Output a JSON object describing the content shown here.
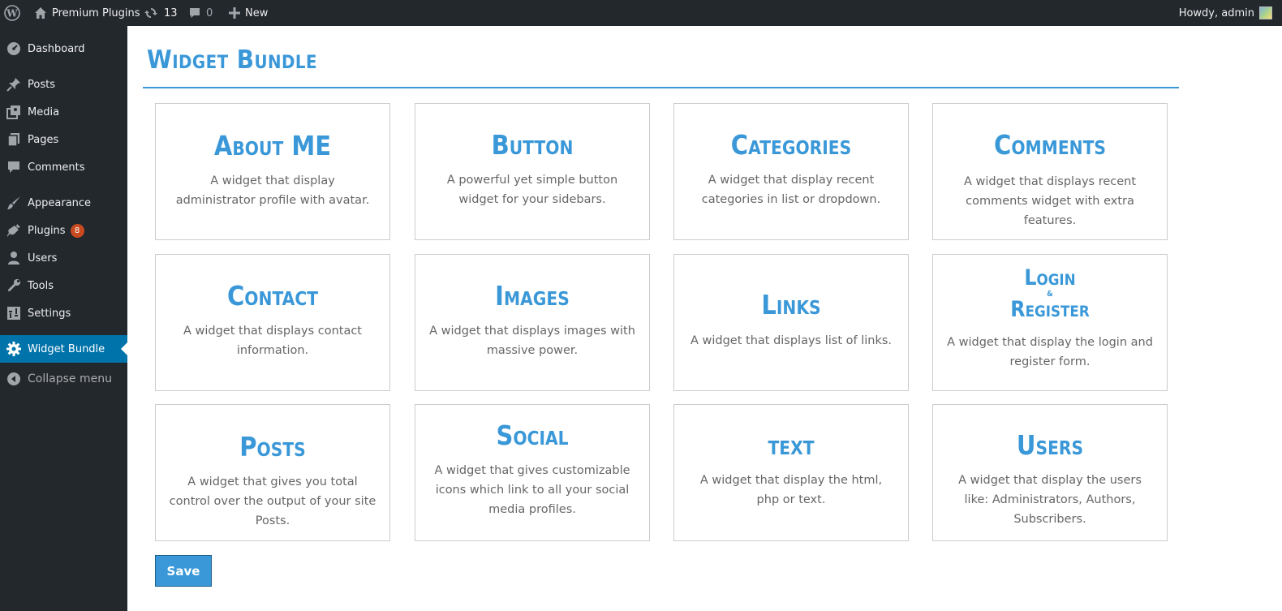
{
  "admin_bar": {
    "site_name": "Premium Plugins",
    "updates_count": "13",
    "comments_count": "0",
    "new_label": "New",
    "greeting": "Howdy, admin"
  },
  "sidebar": {
    "items": [
      {
        "label": "Dashboard",
        "icon": "dashboard-icon"
      },
      {
        "label": "Posts",
        "icon": "pin-icon"
      },
      {
        "label": "Media",
        "icon": "media-icon"
      },
      {
        "label": "Pages",
        "icon": "pages-icon"
      },
      {
        "label": "Comments",
        "icon": "comment-icon"
      },
      {
        "label": "Appearance",
        "icon": "brush-icon"
      },
      {
        "label": "Plugins",
        "icon": "plugin-icon",
        "badge": "8"
      },
      {
        "label": "Users",
        "icon": "user-icon"
      },
      {
        "label": "Tools",
        "icon": "wrench-icon"
      },
      {
        "label": "Settings",
        "icon": "settings-icon"
      },
      {
        "label": "Widget Bundle",
        "icon": "gear-icon",
        "current": true
      }
    ],
    "collapse_label": "Collapse menu"
  },
  "page": {
    "title": "Widget Bundle",
    "save_label": "Save"
  },
  "widgets": [
    {
      "title": "About ME",
      "description": "A widget that display administrator profile with avatar."
    },
    {
      "title": "Button",
      "description": "A powerful yet simple button widget for your sidebars."
    },
    {
      "title": "Categories",
      "description": "A widget that display recent categories in list or dropdown."
    },
    {
      "title": "Comments",
      "description": "A widget that displays recent comments widget with extra features."
    },
    {
      "title": "Contact",
      "description": "A widget that displays contact information."
    },
    {
      "title": "Images",
      "description": "A widget that displays images with massive power."
    },
    {
      "title": "Links",
      "description": "A widget that displays list of links."
    },
    {
      "title_line1": "Login",
      "title_amp": "&",
      "title_line2": "Register",
      "description": "A widget that display the login and register form."
    },
    {
      "title": "Posts",
      "description": "A widget that gives you total control over the output of your site Posts."
    },
    {
      "title": "Social",
      "description": "A widget that gives customizable icons which link to all your social media profiles."
    },
    {
      "title": "text",
      "description": "A widget that display the html, php or text."
    },
    {
      "title": "Users",
      "description": "A widget that display the users like: Administrators, Authors, Subscribers."
    }
  ],
  "colors": {
    "accent": "#3a98d8",
    "admin_bg": "#23282d",
    "current_menu": "#0073aa",
    "badge": "#ca4a1f"
  }
}
